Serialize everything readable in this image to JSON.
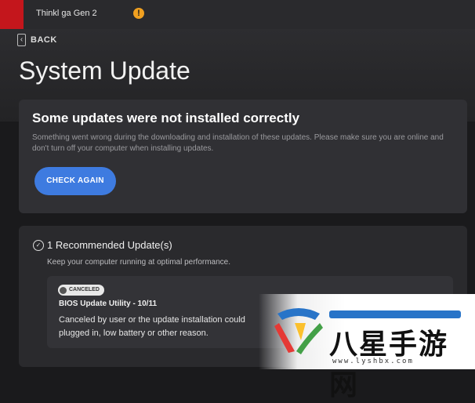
{
  "titlebar": {
    "device_name": "Thinkl      ga Gen 2",
    "warning_icon": "warning-icon",
    "brand_color": "#c4161c"
  },
  "nav": {
    "back_label": "BACK"
  },
  "page": {
    "title": "System Update"
  },
  "alert_card": {
    "title": "Some updates were not installed correctly",
    "description": "Something went wrong during the downloading and installation of these updates. Please make sure you are online and don't turn off your computer when installing updates.",
    "button_label": "CHECK AGAIN",
    "accent_color": "#3e7be0"
  },
  "recommended": {
    "title": "1 Recommended Update(s)",
    "subtitle": "Keep your computer running at optimal performance.",
    "items": [
      {
        "status": "CANCELED",
        "name": "BIOS Update Utility - 10/11",
        "description": "Canceled by user or the update installation could plugged in, low battery or other reason."
      }
    ]
  },
  "watermark": {
    "text": "八星手游网",
    "url": "www.lyshbx.com"
  }
}
